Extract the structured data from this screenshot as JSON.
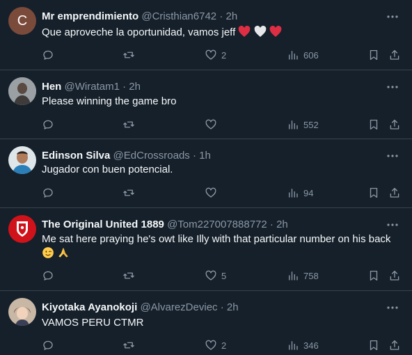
{
  "tweets": [
    {
      "name": "Mr emprendimiento",
      "handle": "@Cristhian6742",
      "separator": "·",
      "time": "2h",
      "avatar_letter": "C",
      "text": "Que aproveche la oportunidad, vamos jeff",
      "emojis": [
        "red-heart",
        "white-heart",
        "red-heart"
      ],
      "replies": "",
      "retweets": "",
      "likes": "2",
      "views": "606"
    },
    {
      "name": "Hen",
      "handle": "@Wiratam1",
      "separator": "·",
      "time": "2h",
      "text": "Please winning the game bro",
      "replies": "",
      "retweets": "",
      "likes": "",
      "views": "552"
    },
    {
      "name": "Edinson Silva",
      "handle": "@EdCrossroads",
      "separator": "·",
      "time": "1h",
      "text": "Jugador con buen potencial.",
      "replies": "",
      "retweets": "",
      "likes": "",
      "views": "94"
    },
    {
      "name": "The Original United 1889",
      "handle": "@Tom227007888772",
      "separator": "·",
      "time": "2h",
      "text": "Me sat here praying he's owt like Illy with that particular number on his back",
      "emojis": [
        "winking-face",
        "folded-hands"
      ],
      "replies": "",
      "retweets": "",
      "likes": "5",
      "views": "758"
    },
    {
      "name": "Kiyotaka Ayanokoji",
      "handle": "@AlvarezDeviec",
      "separator": "·",
      "time": "2h",
      "text": "VAMOS PERU CTMR",
      "replies": "",
      "retweets": "",
      "likes": "2",
      "views": "346"
    }
  ],
  "colors": {
    "background": "#15202b",
    "divider": "#38444d",
    "text": "#f7f9f9",
    "secondary": "#8b98a5"
  }
}
